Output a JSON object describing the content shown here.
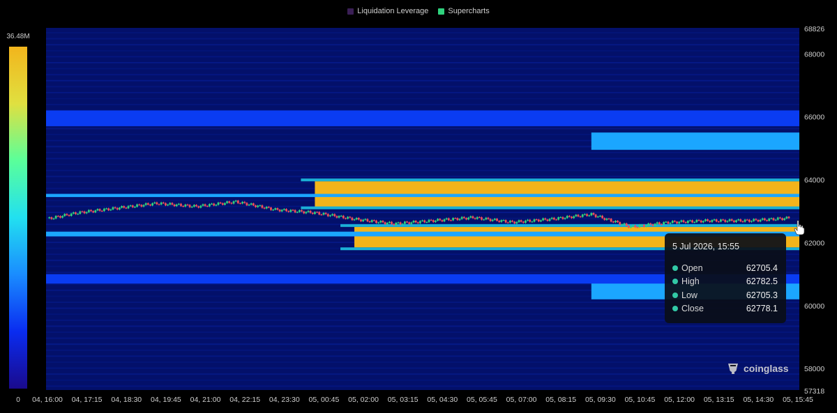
{
  "legend": [
    {
      "label": "Liquidation Leverage",
      "color": "#3a1f55"
    },
    {
      "label": "Supercharts",
      "color": "#2fd27d"
    }
  ],
  "colorbar": {
    "max_label": "36.48M",
    "min_label": "0",
    "stops": [
      "#1a0a8c",
      "#0a2cf0",
      "#1a8cff",
      "#22e0f0",
      "#5aff9a",
      "#e0e040",
      "#f2b51c"
    ]
  },
  "tooltip": {
    "title": "5 Jul 2026, 15:55",
    "rows": [
      {
        "label": "Open",
        "value": "62705.4"
      },
      {
        "label": "High",
        "value": "62782.5"
      },
      {
        "label": "Low",
        "value": "62705.3"
      },
      {
        "label": "Close",
        "value": "62778.1"
      }
    ]
  },
  "brand": {
    "name": "coinglass"
  },
  "chart_data": {
    "type": "heatmap",
    "title": "",
    "xlabel": "",
    "ylabel": "",
    "ylim": [
      57318,
      68826
    ],
    "y_ticks": [
      "68826",
      "68000",
      "66000",
      "64000",
      "62000",
      "60000",
      "58000",
      "57318"
    ],
    "x_ticks": [
      "04, 16:00",
      "04, 17:15",
      "04, 18:30",
      "04, 19:45",
      "04, 21:00",
      "04, 22:15",
      "04, 23:30",
      "05, 00:45",
      "05, 02:00",
      "05, 03:15",
      "05, 04:30",
      "05, 05:45",
      "05, 07:00",
      "05, 08:15",
      "05, 09:30",
      "05, 10:45",
      "05, 12:00",
      "05, 13:15",
      "05, 14:30",
      "05, 15:45"
    ],
    "price_series": {
      "name": "Supercharts",
      "x": [
        "04, 16:00",
        "04, 17:15",
        "04, 18:30",
        "04, 19:45",
        "04, 21:00",
        "04, 22:15",
        "04, 23:30",
        "05, 00:45",
        "05, 02:00",
        "05, 03:15",
        "05, 04:30",
        "05, 05:45",
        "05, 07:00",
        "05, 08:15",
        "05, 09:30",
        "05, 10:45",
        "05, 12:00",
        "05, 13:15",
        "05, 14:30",
        "05, 15:45"
      ],
      "values": [
        62700,
        62950,
        63100,
        63250,
        63150,
        63300,
        63050,
        62950,
        62750,
        62600,
        62700,
        62800,
        62650,
        62750,
        62900,
        62500,
        62650,
        62700,
        62700,
        62780
      ]
    },
    "liquidation_bands": [
      {
        "price_low": 63150,
        "price_high": 63950,
        "start": "05, 00:45",
        "end": "05, 15:45",
        "level": "high"
      },
      {
        "price_low": 61850,
        "price_high": 62500,
        "start": "05, 02:00",
        "end": "05, 15:45",
        "level": "high"
      },
      {
        "price_low": 63450,
        "price_high": 63550,
        "start": "04, 16:00",
        "end": "05, 15:45",
        "level": "medium"
      },
      {
        "price_low": 62200,
        "price_high": 62350,
        "start": "04, 16:00",
        "end": "05, 15:45",
        "level": "medium"
      },
      {
        "price_low": 64950,
        "price_high": 65500,
        "start": "05, 09:30",
        "end": "05, 15:45",
        "level": "medium"
      },
      {
        "price_low": 60200,
        "price_high": 60800,
        "start": "05, 09:30",
        "end": "05, 15:45",
        "level": "medium"
      },
      {
        "price_low": 65700,
        "price_high": 66200,
        "start": "04, 16:00",
        "end": "05, 15:45",
        "level": "low"
      },
      {
        "price_low": 60700,
        "price_high": 61000,
        "start": "04, 16:00",
        "end": "05, 15:45",
        "level": "low"
      }
    ]
  }
}
